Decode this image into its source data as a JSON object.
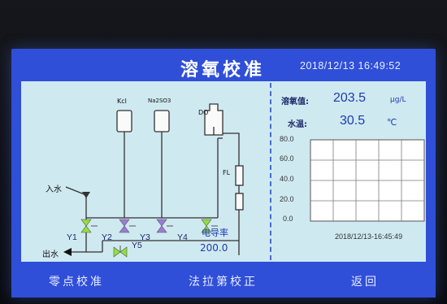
{
  "header": {
    "title": "溶氧校准",
    "datetime": "2018/12/13 16:49:52"
  },
  "readings": {
    "do_label": "溶氧值:",
    "do_value": "203.5",
    "do_unit": "μg/L",
    "temp_label": "水温:",
    "temp_value": "30.5",
    "temp_unit": "℃"
  },
  "diagram": {
    "inlet_label": "入水",
    "outlet_label": "出水",
    "kcl_label": "Kcl",
    "na2so3_label": "Na2SO3",
    "do_label": "DO",
    "fl_label": "FL",
    "conductivity_label": "电导率",
    "conductivity_value": "200.0",
    "valves": [
      "Y1",
      "Y2",
      "Y3",
      "Y4",
      "Y5"
    ]
  },
  "chart_data": {
    "type": "line",
    "y_ticks": [
      "80.0",
      "60.0",
      "40.0",
      "20.0",
      "0.0"
    ],
    "ylim": [
      0,
      80
    ],
    "grid": true,
    "series": [],
    "timestamp": "2018/12/13-16:45:49"
  },
  "footer": {
    "zero_cal": "零点校准",
    "faraday_cal": "法拉第校正",
    "back": "返回"
  },
  "colors": {
    "screen_blue": "#2f4fd8",
    "panel_bg": "#cfe9f0",
    "valve_green": "#8fe23a",
    "valve_purple": "#9b7bd8",
    "text_blue": "#1f3bb0"
  }
}
